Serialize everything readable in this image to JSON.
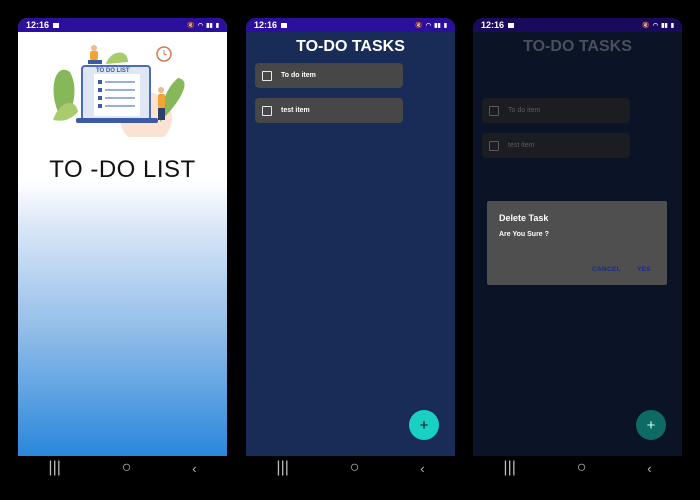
{
  "status": {
    "time": "12:16"
  },
  "splash": {
    "board_label": "TO DO LIST",
    "title": "TO -DO LIST"
  },
  "list": {
    "title": "TO-DO TASKS",
    "tasks": [
      {
        "label": "To do item",
        "checked": false
      },
      {
        "label": "test item",
        "checked": false
      }
    ],
    "fab_label": "+"
  },
  "dialog": {
    "title": "Delete Task",
    "message": "Are You Sure ?",
    "cancel_label": "CANCEL",
    "confirm_label": "YES"
  },
  "navbar": {
    "recents": "|||",
    "home": "○",
    "back": "‹"
  },
  "colors": {
    "status_bar": "#2c0f9c",
    "list_background": "#192b57",
    "task_card": "#474747",
    "fab": "#19d0c2",
    "dialog_button": "#1b2a8a"
  }
}
